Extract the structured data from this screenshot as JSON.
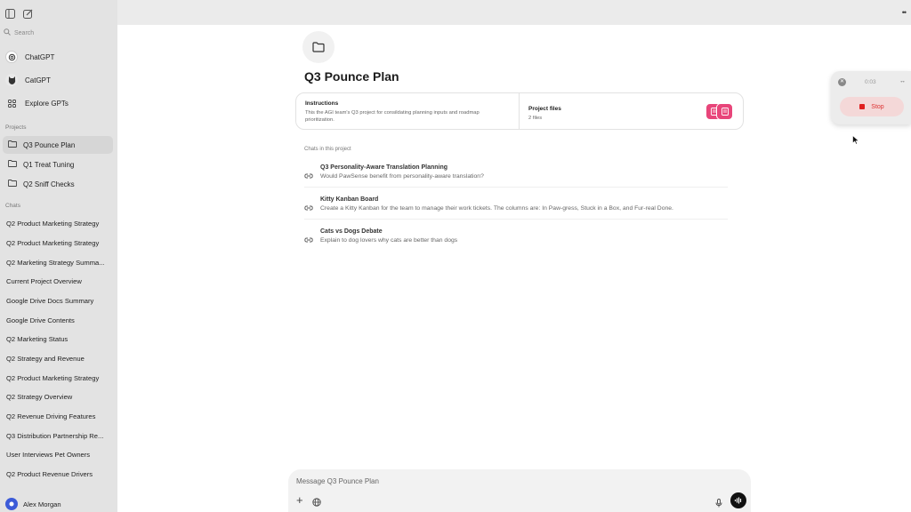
{
  "sidebar": {
    "search_placeholder": "Search",
    "gpts": [
      {
        "label": "ChatGPT",
        "icon": "chatgpt-icon"
      },
      {
        "label": "CatGPT",
        "icon": "cat-icon"
      },
      {
        "label": "Explore GPTs",
        "icon": "grid-icon"
      }
    ],
    "projects_label": "Projects",
    "projects": [
      {
        "label": "Q3 Pounce Plan"
      },
      {
        "label": "Q1 Treat Tuning"
      },
      {
        "label": "Q2 Sniff Checks"
      }
    ],
    "chats_label": "Chats",
    "chats": [
      "Q2 Product Marketing Strategy",
      "Q2 Product Marketing Strategy",
      "Q2 Marketing Strategy Summa...",
      "Current Project Overview",
      "Google Drive Docs Summary",
      "Google Drive Contents",
      "Q2 Marketing Status",
      "Q2 Strategy and Revenue",
      "Q2 Product Marketing Strategy",
      "Q2 Strategy Overview",
      "Q2 Revenue Driving Features",
      "Q3 Distribution Partnership Re...",
      "User Interviews Pet Owners",
      "Q2 Product Revenue Drivers"
    ],
    "user_name": "Alex Morgan"
  },
  "main": {
    "title": "Q3 Pounce Plan",
    "instructions_heading": "Instructions",
    "instructions_text": "This the AGI team's Q3 project for consildating planning inputs and roadmap prioritization.",
    "files_heading": "Project files",
    "files_count": "2 files",
    "chats_in_project_label": "Chats in this project",
    "project_chats": [
      {
        "title": "Q3 Personality-Aware Translation Planning",
        "snippet": "Would PawSense benefit from personality-aware translation?"
      },
      {
        "title": "Kitty Kanban Board",
        "snippet": "Create a Kitty Kanban for the team to manage their work tickets. The columns are: In Paw-gress, Stuck in a Box, and Fur-real Done."
      },
      {
        "title": "Cats vs Dogs Debate",
        "snippet": "Explain to dog lovers why cats are better than dogs"
      }
    ],
    "composer_placeholder": "Message Q3 Pounce Plan"
  },
  "recorder": {
    "time": "0:03",
    "stop_label": "Stop"
  },
  "colors": {
    "accent_pink": "#e8457a",
    "stop_red": "#e02020",
    "avatar_blue": "#3c5bd8"
  }
}
